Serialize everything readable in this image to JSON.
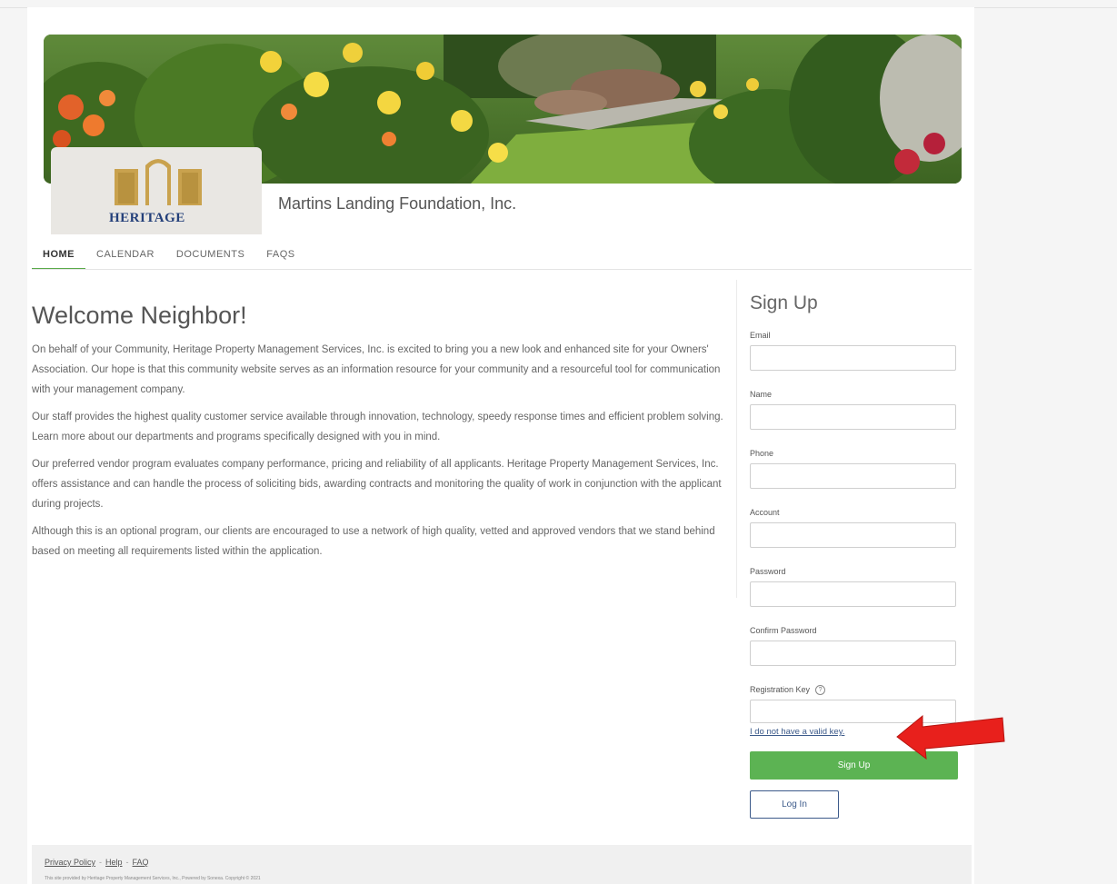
{
  "header": {
    "org_name": "Martins Landing Foundation, Inc.",
    "logo_text": "HERITAGE"
  },
  "nav": {
    "items": [
      {
        "label": "HOME",
        "active": true
      },
      {
        "label": "CALENDAR",
        "active": false
      },
      {
        "label": "DOCUMENTS",
        "active": false
      },
      {
        "label": "FAQS",
        "active": false
      }
    ]
  },
  "main": {
    "title": "Welcome Neighbor!",
    "paragraphs": [
      "On behalf of your Community, Heritage Property Management Services, Inc. is excited to bring you a new look and enhanced site for your Owners' Association. Our hope is that this community website serves as an information resource for your community and a resourceful tool for communication with your management company.",
      "Our staff provides the highest quality customer service available through innovation, technology, speedy response times and efficient problem solving. Learn more about our departments and programs specifically designed with you in mind.",
      "Our preferred vendor program evaluates company performance, pricing and reliability of all applicants. Heritage Property Management Services, Inc. offers assistance and can handle the process of soliciting bids, awarding contracts and monitoring the quality of work in conjunction with the applicant during projects.",
      "Although this is an optional program, our clients are encouraged to use a network of high quality, vetted and approved vendors that we stand behind based on meeting all requirements listed within the application."
    ]
  },
  "signup": {
    "title": "Sign Up",
    "fields": {
      "email": {
        "label": "Email",
        "value": ""
      },
      "name": {
        "label": "Name",
        "value": ""
      },
      "phone": {
        "label": "Phone",
        "value": ""
      },
      "account": {
        "label": "Account",
        "value": ""
      },
      "password": {
        "label": "Password",
        "value": ""
      },
      "confirm_password": {
        "label": "Confirm Password",
        "value": ""
      },
      "registration_key": {
        "label": "Registration Key",
        "value": ""
      }
    },
    "help_glyph": "?",
    "no_key_link": "I do not have a valid key.",
    "signup_button": "Sign Up",
    "login_button": "Log In"
  },
  "footer": {
    "links": [
      "Privacy Policy",
      "Help",
      "FAQ"
    ],
    "copyright": "This site provided by Heritage Property Management Services, Inc., Powered by Sonexa. Copyright © 2021"
  },
  "colors": {
    "accent_green": "#5cb353",
    "link_blue": "#3c5a8a",
    "logo_blue": "#24407a",
    "annotation_red": "#e8201c"
  },
  "icons": {
    "help": "question-circle-icon",
    "annotation": "red-arrow-icon"
  }
}
